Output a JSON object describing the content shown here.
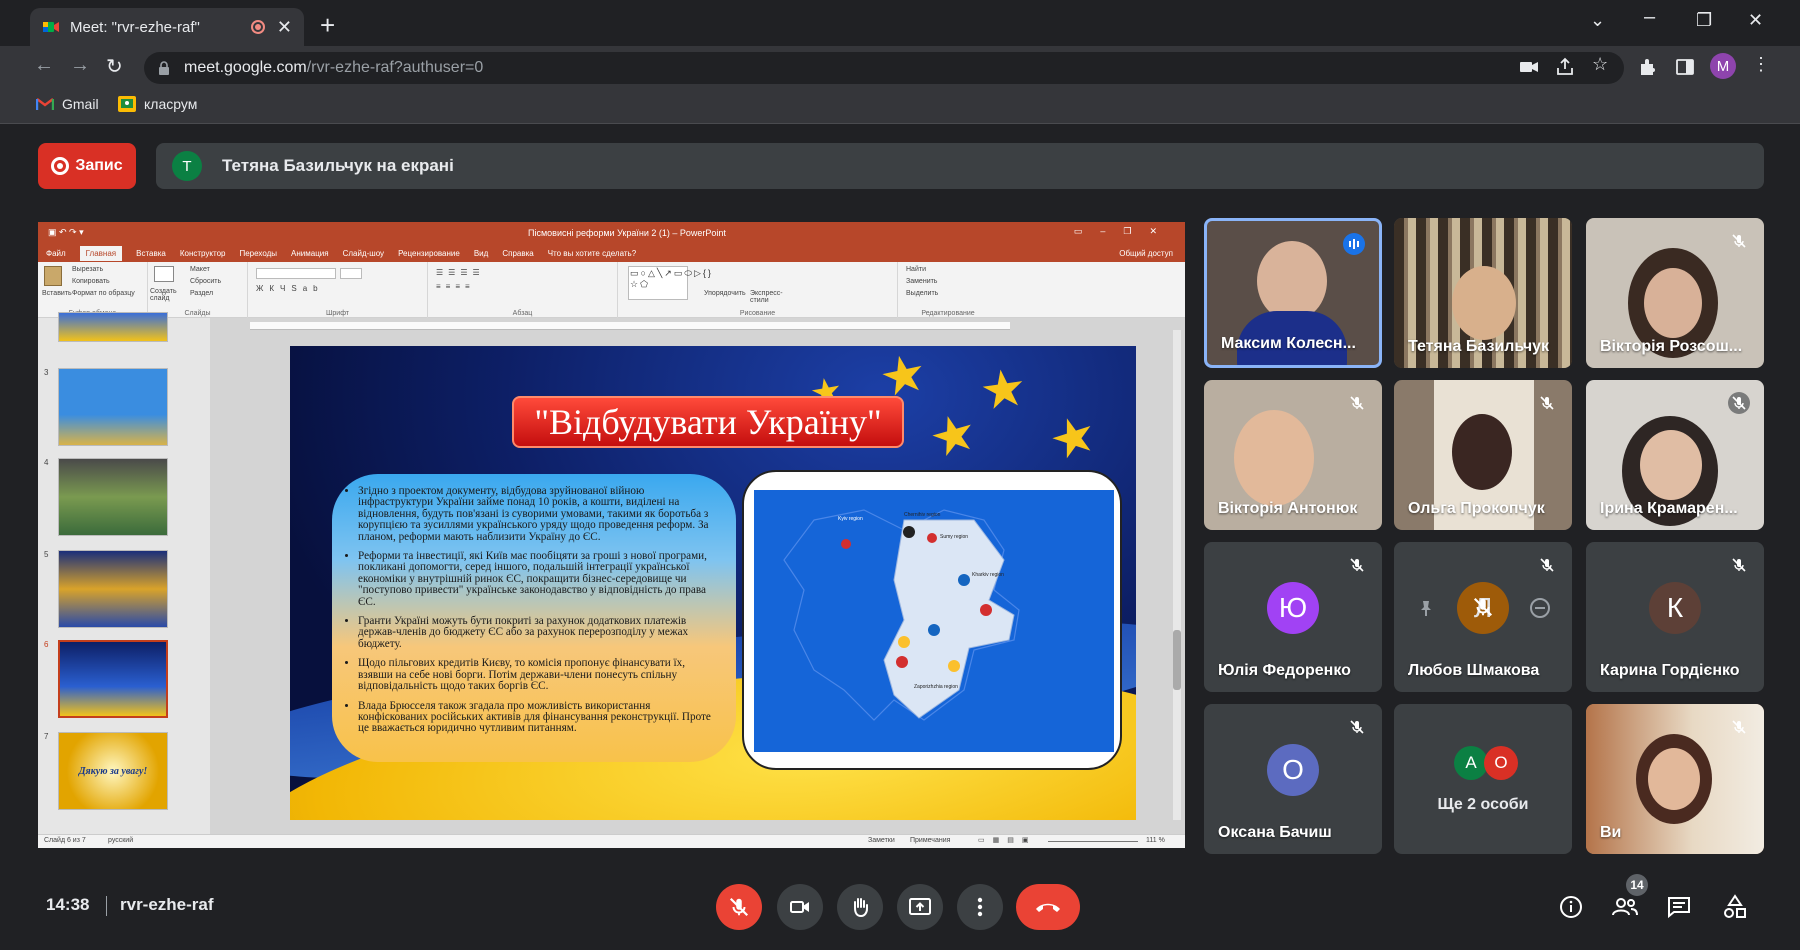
{
  "browser": {
    "tab_title": "Meet: \"rvr-ezhe-raf\"",
    "url_host": "meet.google.com",
    "url_path": "/rvr-ezhe-raf?authuser=0",
    "profile_initial": "M",
    "bookmarks": [
      {
        "label": "Gmail",
        "icon": "gmail-icon"
      },
      {
        "label": "класрум",
        "icon": "classroom-icon"
      }
    ]
  },
  "meet": {
    "record_label": "Запис",
    "presenter_initial": "T",
    "presenting_text": "Тетяна Базильчук на екрані",
    "time": "14:38",
    "meeting_code": "rvr-ezhe-raf",
    "participant_count": "14",
    "colors": {
      "accent_red": "#ea4335",
      "tile_bg": "#3c4043",
      "active_speaker": "#8ab4f8"
    }
  },
  "powerpoint": {
    "title_bar": "Пісмовисні реформи України 2 (1) – PowerPoint",
    "share_label": "Общий доступ",
    "tell_me": "Что вы хотите сделать?",
    "ribbon_tabs": [
      "Файл",
      "Главная",
      "Вставка",
      "Конструктор",
      "Переходы",
      "Анимация",
      "Слайд-шоу",
      "Рецензирование",
      "Вид",
      "Справка"
    ],
    "ribbon_groups": [
      "Буфер обмена",
      "Слайды",
      "Шрифт",
      "Абзац",
      "Рисование",
      "Редактирование"
    ],
    "ribbon_items": {
      "paste": "Вставить",
      "cut": "Вырезать",
      "copy": "Копировать",
      "format": "Формат по образцу",
      "create_slide": "Создать слайд",
      "layout": "Макет",
      "reset": "Сбросить",
      "section": "Раздел",
      "arrange": "Упорядочить",
      "express": "Экспресс-стили",
      "find": "Найти",
      "replace": "Заменить",
      "select": "Выделить"
    },
    "thumb_numbers": [
      "3",
      "4",
      "5",
      "6",
      "7"
    ],
    "thumb7_text": "Дякую за увагу!",
    "status_left": "Слайд 6 из 7",
    "status_lang": "русский",
    "status_notes": "Заметки",
    "status_comments": "Примечания",
    "zoom": "111 %"
  },
  "slide": {
    "title": "\"Відбудувати Україну\"",
    "bullets": [
      "Згідно з проектом документу, відбудова зруйнованої війною інфраструктури України займе понад 10 років, а кошти, виділені на відновлення, будуть пов'язані із суворими умовами, такими як боротьба з корупцією та зусиллями українського уряду щодо проведення реформ. За планом, реформи мають наблизити Україну до ЄС.",
      "Реформи та інвестиції, які Київ має пообіцяти за гроші з нової програми, покликані допомогти, серед іншого, подальшій інтеграції української економіки у внутрішній ринок ЄС, покращити бізнес-середовище чи \"поступово привести\" українське законодавство у відповідність до права ЄС.",
      "Гранти Україні можуть бути покриті за рахунок додаткових платежів держав-членів до бюджету ЄС або за рахунок перерозподілу у межах бюджету.",
      "Щодо пільгових кредитів Києву, то комісія пропонує фінансувати їх, взявши на себе нові борги. Потім держави-члени понесуть спільну відповідальність щодо таких боргів ЄС.",
      "Влада Брюсселя також згадала про можливість використання конфіскованих російських активів для фінансування реконструкції. Проте це вважається юридично чутливим питанням."
    ],
    "map_labels": [
      "Chernihiv region",
      "Sumy region",
      "Kharkiv region",
      "Kyiv region",
      "Zaporizhzhia region"
    ]
  },
  "participants": [
    {
      "name": "Максим Колесн...",
      "type": "video",
      "muted": false,
      "speaking": true
    },
    {
      "name": "Тетяна Базильчук",
      "type": "video",
      "muted": false,
      "speaking": false
    },
    {
      "name": "Вікторія Розсош...",
      "type": "video",
      "muted": true
    },
    {
      "name": "Вікторія Антонюк",
      "type": "video",
      "muted": true
    },
    {
      "name": "Ольга Прокопчук",
      "type": "video",
      "muted": true
    },
    {
      "name": "Ірина Крамарен...",
      "type": "video",
      "muted": true
    },
    {
      "name": "Юлія Федоренко",
      "type": "avatar",
      "initial": "Ю",
      "color": "#a142f4",
      "muted": true
    },
    {
      "name": "Любов Шмакова",
      "type": "avatar",
      "initial": "Л",
      "color": "#b06000",
      "muted": true
    },
    {
      "name": "Карина Гордієнко",
      "type": "avatar",
      "initial": "К",
      "color": "#5d4037",
      "muted": true
    },
    {
      "name": "Оксана Бачиш",
      "type": "avatar",
      "initial": "О",
      "color": "#5c6bc0",
      "muted": true
    },
    {
      "name": "Ще 2 особи",
      "type": "more",
      "initials": [
        "А",
        "О"
      ],
      "colors": [
        "#0b8043",
        "#d93025"
      ]
    },
    {
      "name": "Ви",
      "type": "video",
      "muted": true
    }
  ]
}
